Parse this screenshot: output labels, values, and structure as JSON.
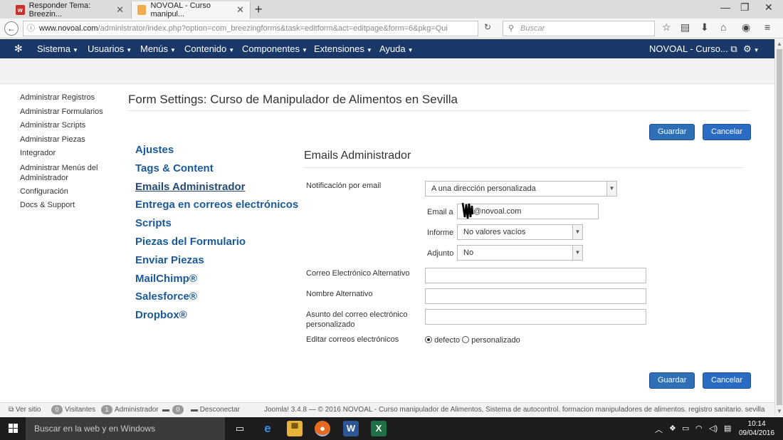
{
  "browser": {
    "tabs": [
      {
        "title": "Responder Tema: Breezin...",
        "favicon": "w-letter-icon"
      },
      {
        "title": "NOVOAL - Curso manipul...",
        "favicon": "joomla-icon"
      }
    ],
    "new_tab": "+",
    "url_domain": "www.novoal.com",
    "url_path": "/administrator/index.php?option=com_breezingforms&task=editform&act=editpage&form=6&pkg=Qui",
    "search_placeholder": "Buscar"
  },
  "joomla_nav": {
    "menus": [
      "Sistema",
      "Usuarios",
      "Menús",
      "Contenido",
      "Componentes",
      "Extensiones",
      "Ayuda"
    ],
    "site_name": "NOVOAL - Curso..."
  },
  "sidebar": {
    "items": [
      {
        "label": "Administrar Registros"
      },
      {
        "label": "Administrar Formularios"
      },
      {
        "label": "Administrar Scripts"
      },
      {
        "label": "Administrar Piezas"
      },
      {
        "label": "Integrador"
      },
      {
        "label": "Administrar Menús del Administrador"
      },
      {
        "label": "Configuración"
      },
      {
        "label": "Docs & Support"
      }
    ]
  },
  "form": {
    "title": "Form Settings: Curso de Manipulador de Alimentos en Sevilla",
    "save_label": "Guardar",
    "cancel_label": "Cancelar"
  },
  "tabs": {
    "items": [
      {
        "label": "Ajustes"
      },
      {
        "label": "Tags & Content"
      },
      {
        "label": "Emails Administrador",
        "active": true
      },
      {
        "label": "Entrega en correos electrónicos"
      },
      {
        "label": "Scripts"
      },
      {
        "label": "Piezas del Formulario"
      },
      {
        "label": "Enviar Piezas"
      },
      {
        "label": "MailChimp®"
      },
      {
        "label": "Salesforce®"
      },
      {
        "label": "Dropbox®"
      }
    ]
  },
  "section": {
    "title": "Emails Administrador",
    "notificacion_label": "Notificación por email",
    "notificacion_value": "A una dirección personalizada",
    "email_a_label": "Email a",
    "email_a_value": "@novoal.com",
    "informe_label": "Informe",
    "informe_value": "No valores vacíos",
    "adjunto_label": "Adjunto",
    "adjunto_value": "No",
    "correo_alt_label": "Correo Electrónico Alternativo",
    "correo_alt_value": "",
    "nombre_alt_label": "Nombre Alternativo",
    "nombre_alt_value": "",
    "asunto_label": "Asunto del correo electrónico personalizado",
    "asunto_value": "",
    "editar_label": "Editar correos electrónicos",
    "editar_options": [
      "defecto",
      "personalizado"
    ],
    "editar_selected": "defecto"
  },
  "footer": {
    "ver_sitio": "Ver sitio",
    "visitantes_count": "0",
    "visitantes_label": "Visitantes",
    "admin_count": "1",
    "admin_label": "Administrador",
    "msg_count": "0",
    "desconectar": "Desconectar",
    "copyright": "Joomla! 3.4.8 — © 2016 NOVOAL - Curso manipulador de Alimentos, Sistema de autocontrol. formacion manipuladores de alimentos. registro sanitario. sevilla"
  },
  "taskbar": {
    "search_placeholder": "Buscar en la web y en Windows",
    "time": "10:14",
    "date": "09/04/2016"
  },
  "colors": {
    "joomla_nav": "#1a3867",
    "button_blue": "#2a6cc4",
    "tab_link": "#1b5a9a"
  }
}
